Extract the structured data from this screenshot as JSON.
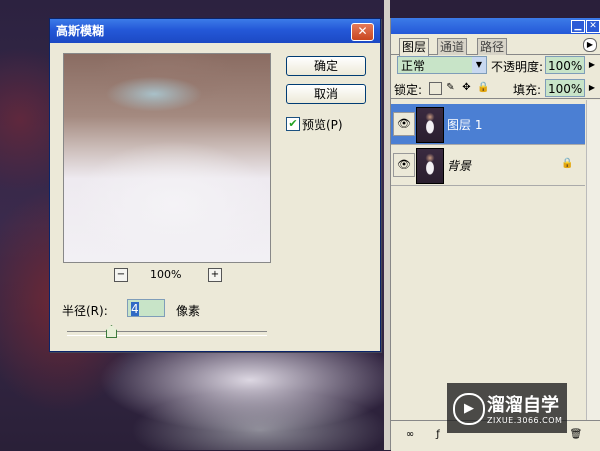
{
  "dialog": {
    "title": "高斯模糊",
    "close_glyph": "✕",
    "ok_label": "确定",
    "cancel_label": "取消",
    "preview_label": "预览(P)",
    "preview_checked": true,
    "zoom_minus": "−",
    "zoom_plus": "+",
    "zoom_value": "100%",
    "radius_label": "半径(R):",
    "radius_value": "4",
    "radius_unit": "像素"
  },
  "panel": {
    "tabs": [
      "图层",
      "通道",
      "路径"
    ],
    "active_tab": "图层",
    "blend_mode": "正常",
    "opacity_label": "不透明度:",
    "opacity_value": "100%",
    "lock_label": "锁定:",
    "fill_label": "填充:",
    "fill_value": "100%",
    "layers": [
      {
        "name": "图层 1",
        "selected": true,
        "visible": true
      },
      {
        "name": "背景",
        "selected": false,
        "visible": true,
        "locked": true
      }
    ]
  },
  "watermark": {
    "title": "溜溜自学",
    "url": "ZIXUE.3066.COM"
  },
  "colors": {
    "titlebar": "#2458d8",
    "selected_layer": "#4b7fd3",
    "input_bg": "#c8e4c8",
    "dialog_bg": "#ece9d8"
  }
}
